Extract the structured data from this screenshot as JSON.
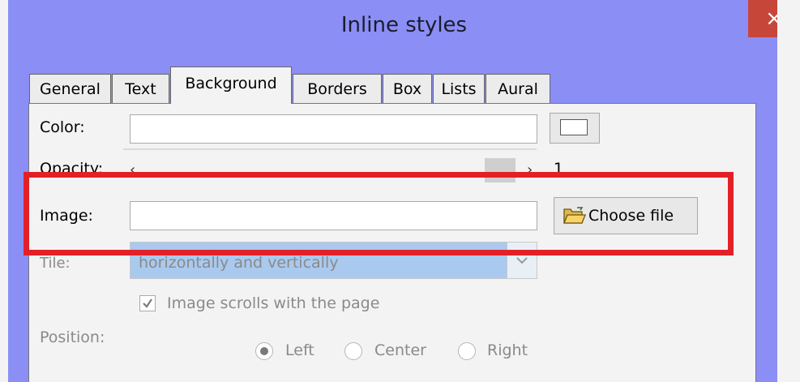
{
  "window": {
    "title": "Inline styles",
    "close_label": "×"
  },
  "tabs": [
    "General",
    "Text",
    "Background",
    "Borders",
    "Box",
    "Lists",
    "Aural"
  ],
  "active_tab": "Background",
  "fields": {
    "color_label": "Color:",
    "opacity_label": "Opacity:",
    "opacity_value": "1",
    "image_label": "Image:",
    "tile_label": "Tile:",
    "tile_value": "horizontally and vertically",
    "choose_file_label": "Choose file",
    "scroll_checkbox_label": "Image scrolls with the page",
    "position_label": "Position:",
    "position_options": [
      "Left",
      "Center",
      "Right"
    ],
    "position_selected": "Left"
  },
  "colors": {
    "title_bar": "#8b8ef5",
    "close": "#c7463a",
    "highlight": "#e42027",
    "tile_select": "#aac9ee"
  }
}
